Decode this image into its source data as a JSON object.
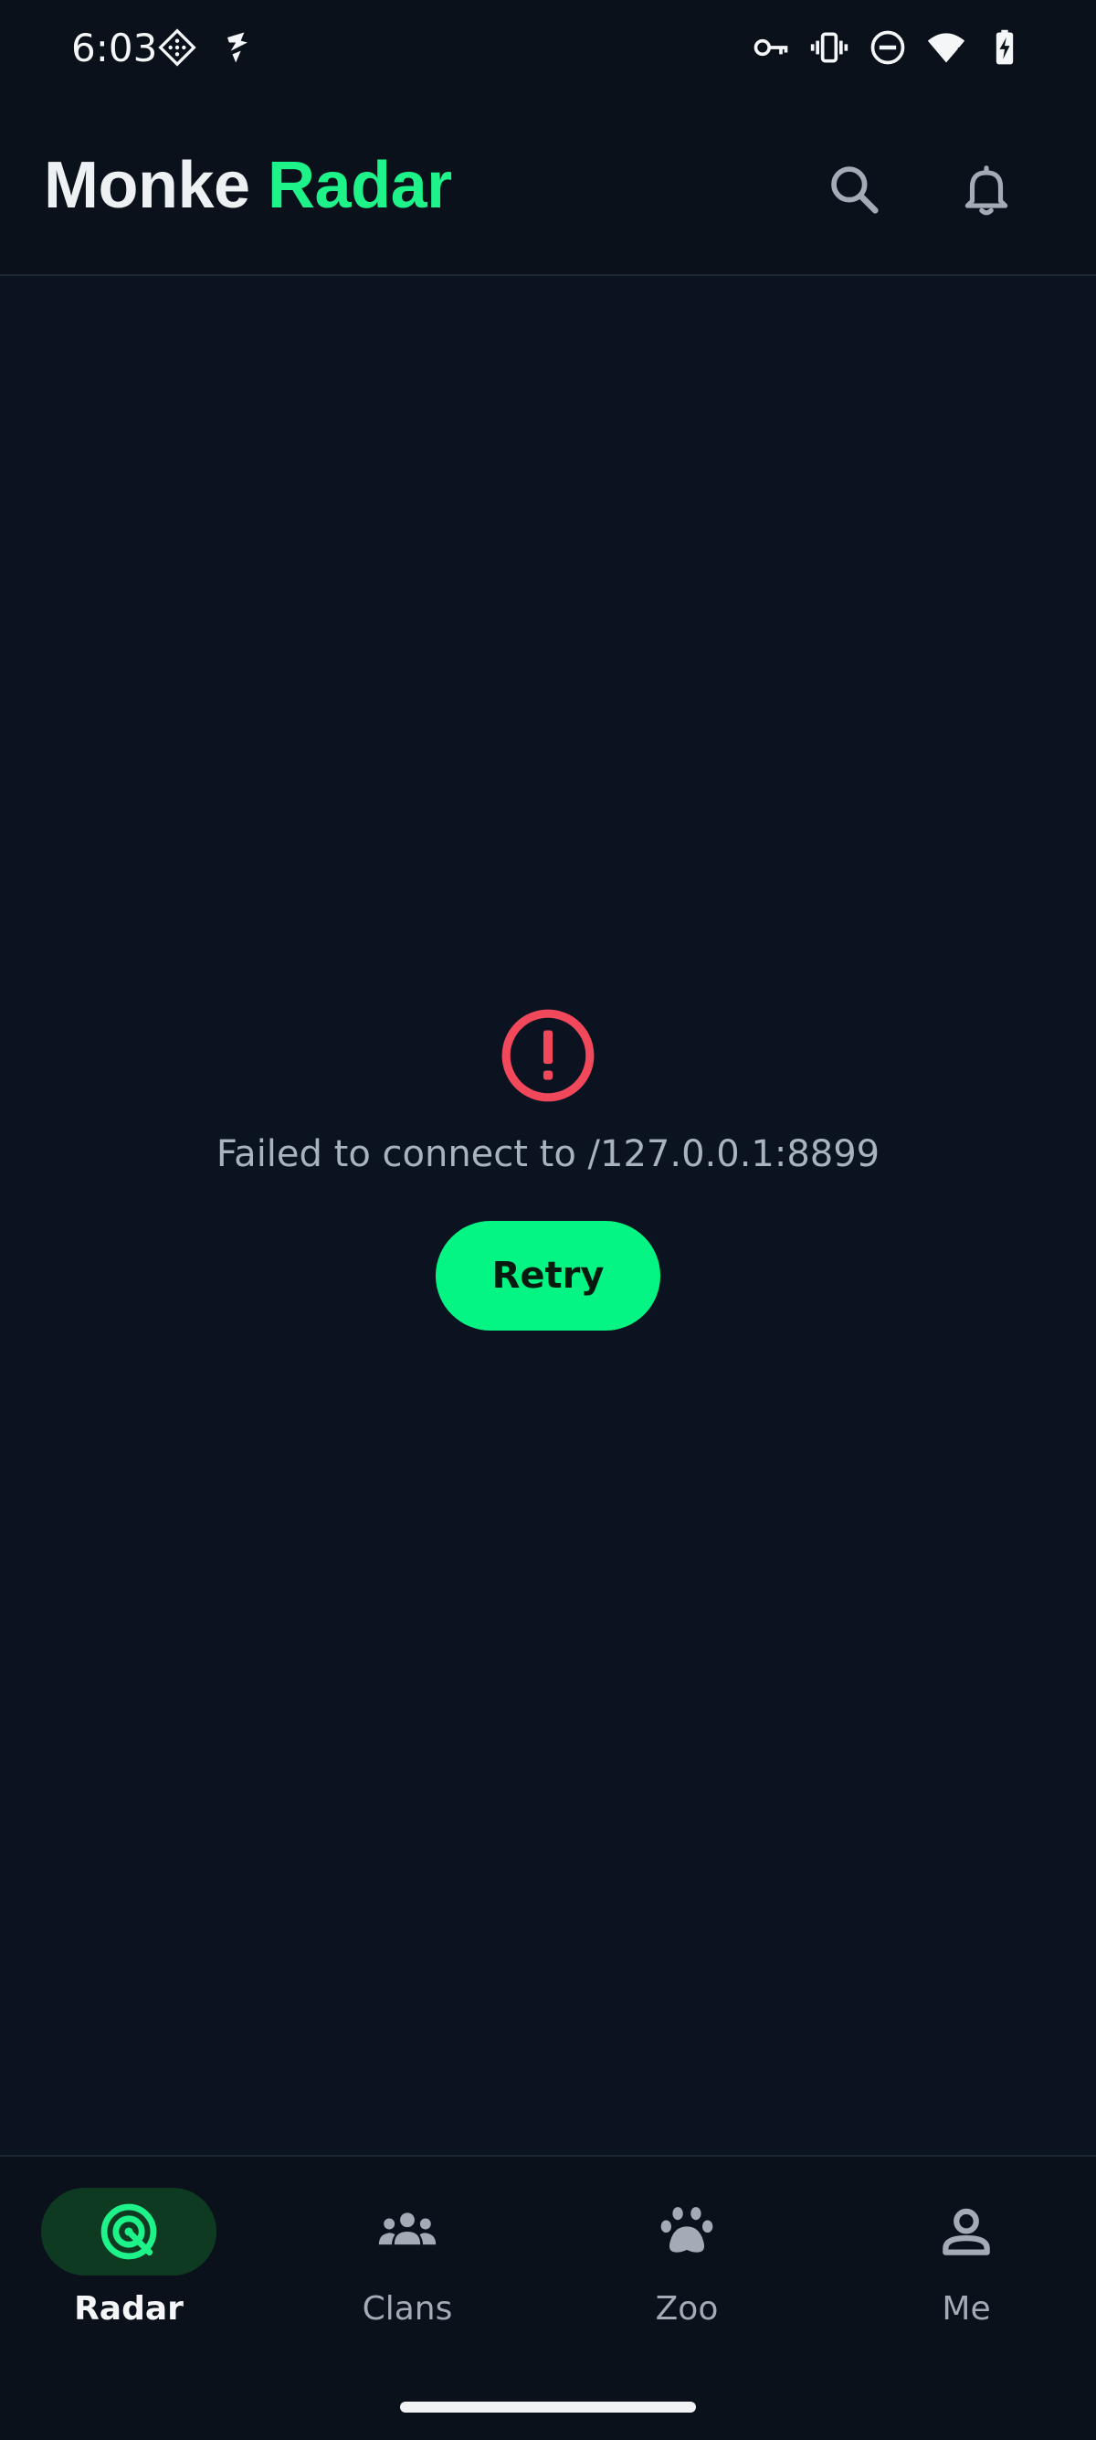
{
  "status_bar": {
    "time": "6:03",
    "left_icons": [
      "app-grid-icon",
      "flash-bolt-icon"
    ],
    "right_icons": [
      "vpn-key-icon",
      "vibrate-icon",
      "do-not-disturb-icon",
      "wifi-alert-icon",
      "battery-charging-icon"
    ]
  },
  "app_bar": {
    "title_part1": "Monke",
    "title_part2": "Radar",
    "actions": [
      "search-icon",
      "bell-icon"
    ]
  },
  "error": {
    "icon": "error-circle-icon",
    "message": "Failed to connect to /127.0.0.1:8899",
    "retry_label": "Retry"
  },
  "bottom_nav": {
    "items": [
      {
        "label": "Radar",
        "icon": "radar-icon",
        "active": true
      },
      {
        "label": "Clans",
        "icon": "group-icon",
        "active": false
      },
      {
        "label": "Zoo",
        "icon": "paw-icon",
        "active": false
      },
      {
        "label": "Me",
        "icon": "person-icon",
        "active": false
      }
    ]
  },
  "colors": {
    "background": "#0b1220",
    "accent_green": "#1ef38a",
    "button_green": "#05f584",
    "error_red": "#f2485b",
    "muted_text": "#a9b3be"
  }
}
